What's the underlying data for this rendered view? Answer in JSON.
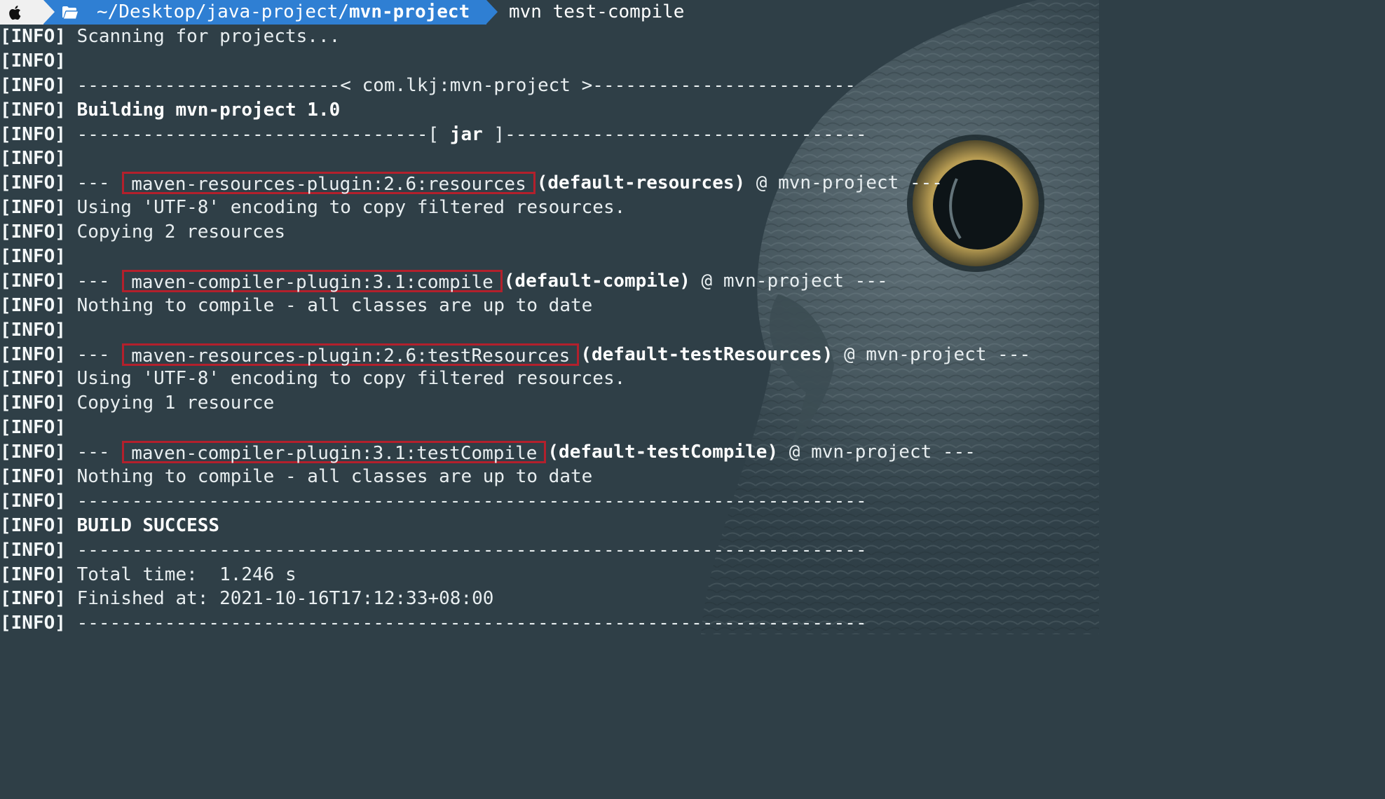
{
  "prompt": {
    "apple_icon": "apple-logo-icon",
    "folder_icon": "folder-open-icon",
    "path_prefix": "~/Desktop/java-project/",
    "path_current": "mvn-project",
    "command": "mvn test-compile"
  },
  "colors": {
    "background": "#2f3f47",
    "prompt_apple_segment": "#f0f0f0",
    "prompt_dir_segment": "#2f7fd3",
    "highlight_box": "#b3202c",
    "text": "#e8eef0"
  },
  "tag": "[INFO]",
  "lines": [
    {
      "parts": [
        {
          "t": "Scanning for projects..."
        }
      ]
    },
    {
      "parts": []
    },
    {
      "parts": [
        {
          "t": "------------------------< com.lkj:mvn-project >------------------------"
        }
      ]
    },
    {
      "parts": [
        {
          "t": "Building mvn-project 1.0",
          "b": true
        }
      ]
    },
    {
      "parts": [
        {
          "t": "--------------------------------[ "
        },
        {
          "t": "jar",
          "b": true
        },
        {
          "t": " ]---------------------------------"
        }
      ]
    },
    {
      "parts": []
    },
    {
      "parts": [
        {
          "t": "--- "
        },
        {
          "t": "maven-resources-plugin:2.6:resources",
          "box": true
        },
        {
          "t": "(default-resources)",
          "b": true
        },
        {
          "t": " @ mvn-project ---"
        }
      ]
    },
    {
      "parts": [
        {
          "t": "Using 'UTF-8' encoding to copy filtered resources."
        }
      ]
    },
    {
      "parts": [
        {
          "t": "Copying 2 resources"
        }
      ]
    },
    {
      "parts": []
    },
    {
      "parts": [
        {
          "t": "--- "
        },
        {
          "t": "maven-compiler-plugin:3.1:compile",
          "box": true
        },
        {
          "t": "(default-compile)",
          "b": true
        },
        {
          "t": " @ mvn-project ---"
        }
      ]
    },
    {
      "parts": [
        {
          "t": "Nothing to compile - all classes are up to date"
        }
      ]
    },
    {
      "parts": []
    },
    {
      "parts": [
        {
          "t": "--- "
        },
        {
          "t": "maven-resources-plugin:2.6:testResources",
          "box": true
        },
        {
          "t": "(default-testResources)",
          "b": true
        },
        {
          "t": " @ mvn-project ---"
        }
      ]
    },
    {
      "parts": [
        {
          "t": "Using 'UTF-8' encoding to copy filtered resources."
        }
      ]
    },
    {
      "parts": [
        {
          "t": "Copying 1 resource"
        }
      ]
    },
    {
      "parts": []
    },
    {
      "parts": [
        {
          "t": "--- "
        },
        {
          "t": "maven-compiler-plugin:3.1:testCompile",
          "box": true
        },
        {
          "t": "(default-testCompile)",
          "b": true
        },
        {
          "t": " @ mvn-project ---"
        }
      ]
    },
    {
      "parts": [
        {
          "t": "Nothing to compile - all classes are up to date"
        }
      ]
    },
    {
      "parts": [
        {
          "t": "------------------------------------------------------------------------"
        }
      ]
    },
    {
      "parts": [
        {
          "t": "BUILD SUCCESS",
          "b": true
        }
      ]
    },
    {
      "parts": [
        {
          "t": "------------------------------------------------------------------------"
        }
      ]
    },
    {
      "parts": [
        {
          "t": "Total time:  1.246 s"
        }
      ]
    },
    {
      "parts": [
        {
          "t": "Finished at: 2021-10-16T17:12:33+08:00"
        }
      ]
    },
    {
      "parts": [
        {
          "t": "------------------------------------------------------------------------"
        }
      ]
    }
  ]
}
